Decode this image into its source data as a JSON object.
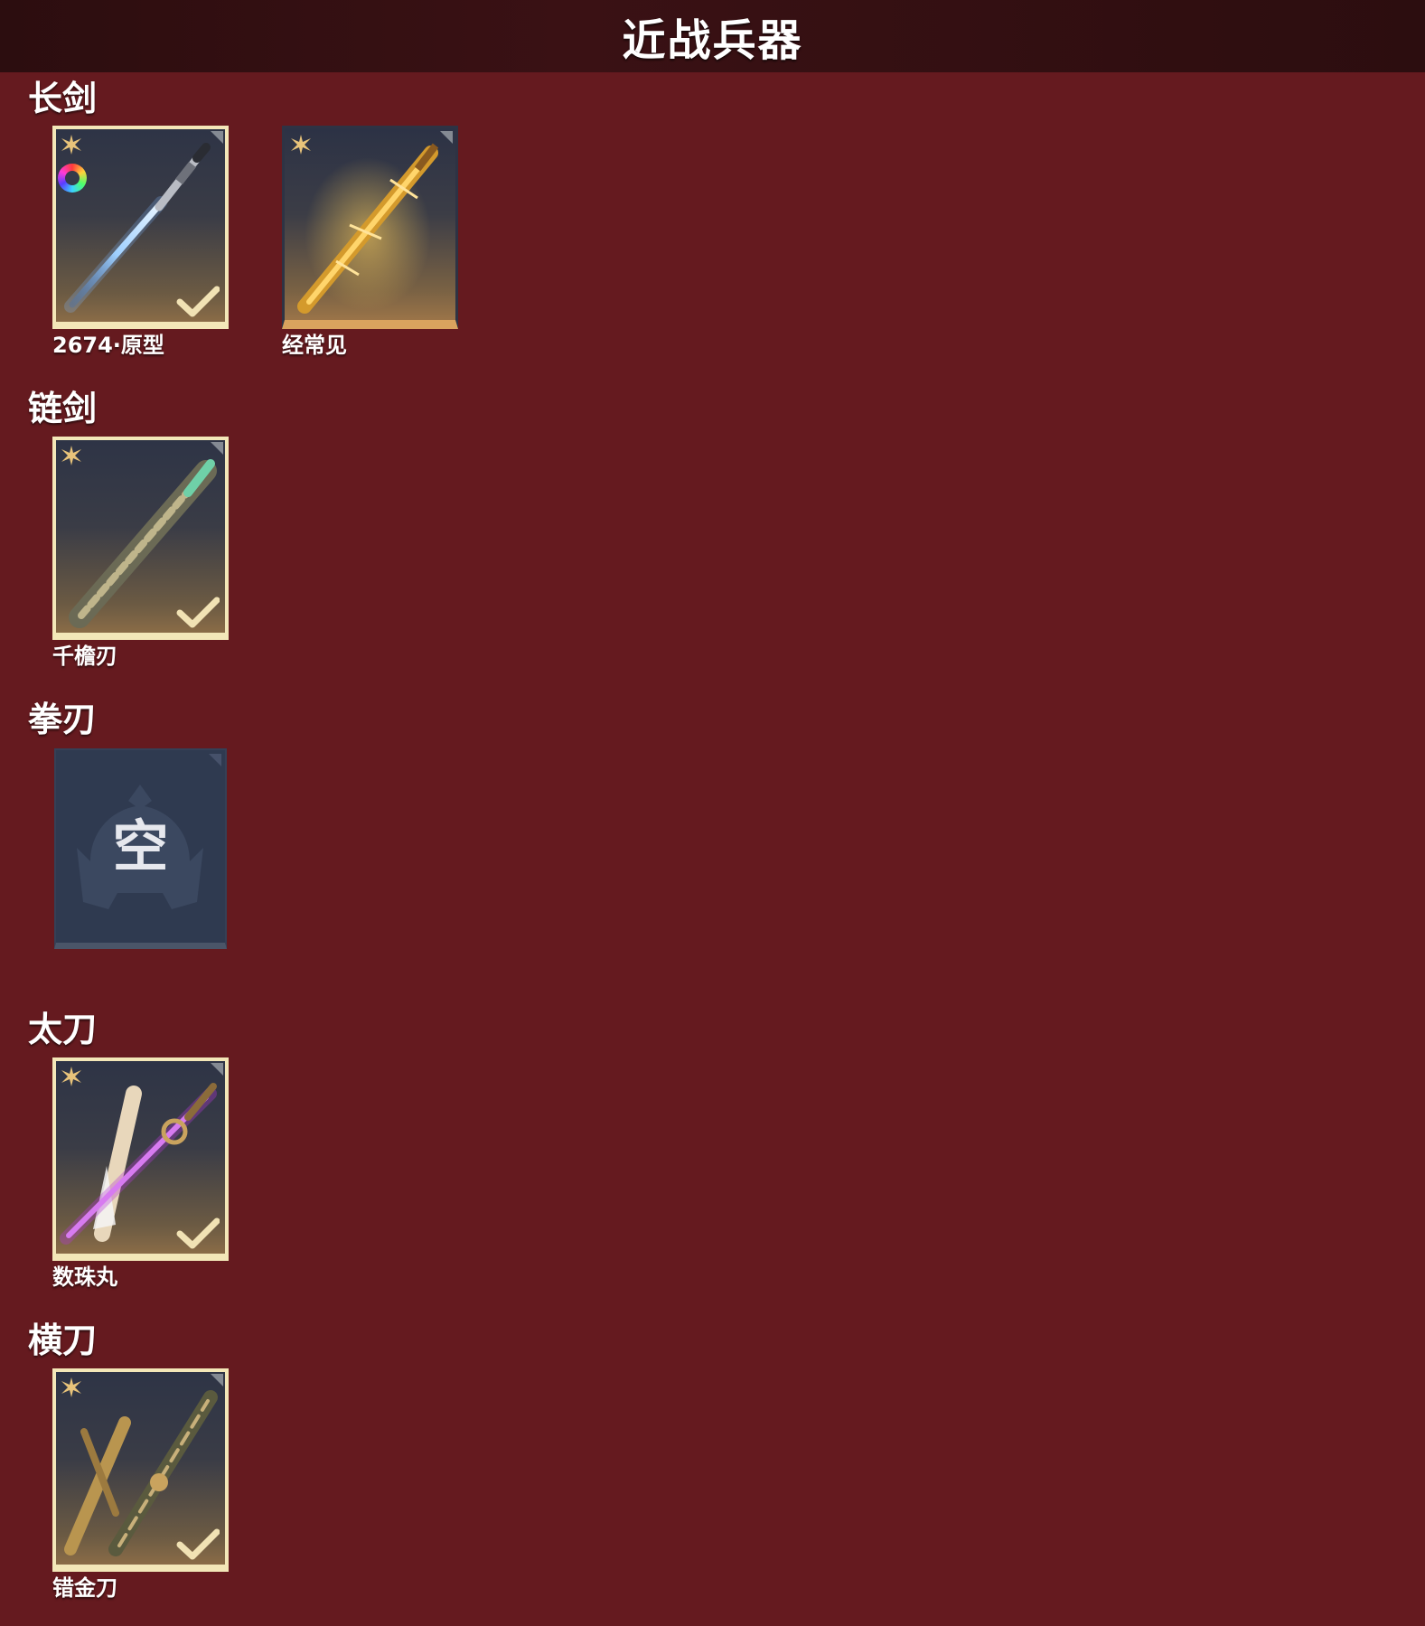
{
  "header": {
    "title": "近战兵器"
  },
  "sections": [
    {
      "name": "长剑",
      "items": [
        {
          "label": "2674·原型",
          "style": "selected",
          "art": "blue-longsword"
        },
        {
          "label": "经常见",
          "style": "gold",
          "art": "golden-sword"
        }
      ]
    },
    {
      "name": "链剑",
      "items": [
        {
          "label": "千檐刃",
          "style": "selected",
          "art": "chain-sword"
        }
      ]
    },
    {
      "name": "拳刃",
      "items": [
        {
          "label": "",
          "style": "empty",
          "empty_text": "空"
        }
      ]
    },
    {
      "name": "太刀",
      "items": [
        {
          "label": "数珠丸",
          "style": "selected",
          "art": "purple-katana"
        }
      ]
    },
    {
      "name": "横刀",
      "items": [
        {
          "label": "错金刀",
          "style": "selected",
          "art": "gold-inlaid-blade"
        }
      ]
    }
  ],
  "icons": {
    "rarity": "star-icon",
    "color_variant": "rainbow-ring-icon",
    "equipped": "check-icon",
    "corner": "corner-tag-icon"
  },
  "colors": {
    "background": "#651a1f",
    "header": "#2c0d0f",
    "selected_border": "#f3e7b8",
    "gold_bar": "#d9a35e",
    "empty_tile": "#2f3a50"
  }
}
